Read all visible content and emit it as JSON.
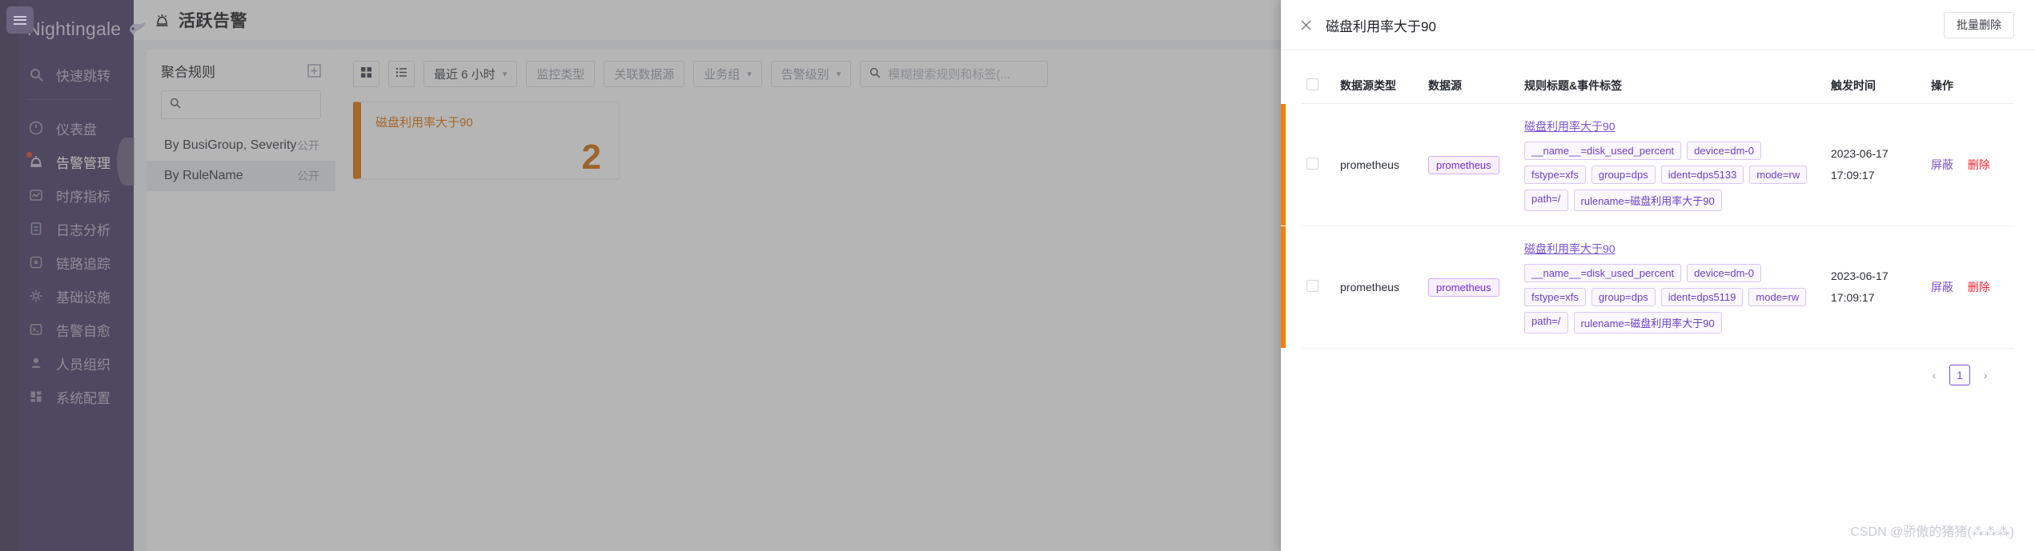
{
  "brand": {
    "name": "Nightingale",
    "logo_icon": "bird-logo-icon"
  },
  "collapse_button": {
    "icon": "menu-collapse-icon"
  },
  "sidebar": {
    "items": [
      {
        "label": "快速跳转",
        "icon": "search-icon",
        "active": false,
        "dot": false
      },
      {
        "label": "仪表盘",
        "icon": "dashboard-icon",
        "active": false,
        "dot": false
      },
      {
        "label": "告警管理",
        "icon": "alarm-bell-icon",
        "active": true,
        "dot": true
      },
      {
        "label": "时序指标",
        "icon": "metrics-chart-icon",
        "active": false,
        "dot": false
      },
      {
        "label": "日志分析",
        "icon": "log-document-icon",
        "active": false,
        "dot": false
      },
      {
        "label": "链路追踪",
        "icon": "trace-link-icon",
        "active": false,
        "dot": false
      },
      {
        "label": "基础设施",
        "icon": "infrastructure-target-icon",
        "active": false,
        "dot": false
      },
      {
        "label": "告警自愈",
        "icon": "terminal-icon",
        "active": false,
        "dot": false
      },
      {
        "label": "人员组织",
        "icon": "user-icon",
        "active": false,
        "dot": false
      },
      {
        "label": "系统配置",
        "icon": "grid-settings-icon",
        "active": false,
        "dot": false
      }
    ]
  },
  "header": {
    "title": "活跃告警",
    "icon": "alarm-bell-icon"
  },
  "aggregation_panel": {
    "title": "聚合规则",
    "add_icon": "add-box-icon",
    "search_placeholder": "",
    "search_value": "",
    "search_icon": "search-icon",
    "items": [
      {
        "label": "By BusiGroup, Severity",
        "badge": "公开",
        "selected": false
      },
      {
        "label": "By RuleName",
        "badge": "公开",
        "selected": true
      }
    ]
  },
  "toolbar": {
    "view_grid_icon": "grid-view-icon",
    "view_list_icon": "list-view-icon",
    "time_range": "最近 6 小时",
    "filters": [
      {
        "label": "监控类型",
        "has_caret": false
      },
      {
        "label": "关联数据源",
        "has_caret": false
      },
      {
        "label": "业务组",
        "has_caret": true
      },
      {
        "label": "告警级别",
        "has_caret": true
      }
    ],
    "search_placeholder": "模糊搜索规则和标签(...",
    "search_icon": "search-icon"
  },
  "cards": [
    {
      "title": "磁盘利用率大于90",
      "count": "2",
      "accent": "#de7408"
    }
  ],
  "drawer": {
    "close_icon": "close-x-icon",
    "title": "磁盘利用率大于90",
    "bulk_delete_label": "批量删除",
    "columns": [
      "数据源类型",
      "数据源",
      "规则标题&事件标签",
      "触发时间",
      "操作"
    ],
    "rows": [
      {
        "datasource_type": "prometheus",
        "datasource": "prometheus",
        "rule_title": "磁盘利用率大于90",
        "tags": [
          "__name__=disk_used_percent",
          "device=dm-0",
          "fstype=xfs",
          "group=dps",
          "ident=dps5133",
          "mode=rw",
          "path=/",
          "rulename=磁盘利用率大于90"
        ],
        "trigger_date": "2023-06-17",
        "trigger_time": "17:09:17",
        "op_mute": "屏蔽",
        "op_delete": "删除"
      },
      {
        "datasource_type": "prometheus",
        "datasource": "prometheus",
        "rule_title": "磁盘利用率大于90",
        "tags": [
          "__name__=disk_used_percent",
          "device=dm-0",
          "fstype=xfs",
          "group=dps",
          "ident=dps5119",
          "mode=rw",
          "path=/",
          "rulename=磁盘利用率大于90"
        ],
        "trigger_date": "2023-06-17",
        "trigger_time": "17:09:17",
        "op_mute": "屏蔽",
        "op_delete": "删除"
      }
    ],
    "pagination": {
      "prev": "‹",
      "page": "1",
      "next": "›"
    }
  },
  "watermark": "CSDN @骄傲的猪猪(⁂⁂⁂)",
  "colors": {
    "sidebar_bg": "#463a64",
    "accent_purple": "#7a52cc",
    "alert_orange": "#de7408",
    "danger_red": "#f5222d"
  }
}
